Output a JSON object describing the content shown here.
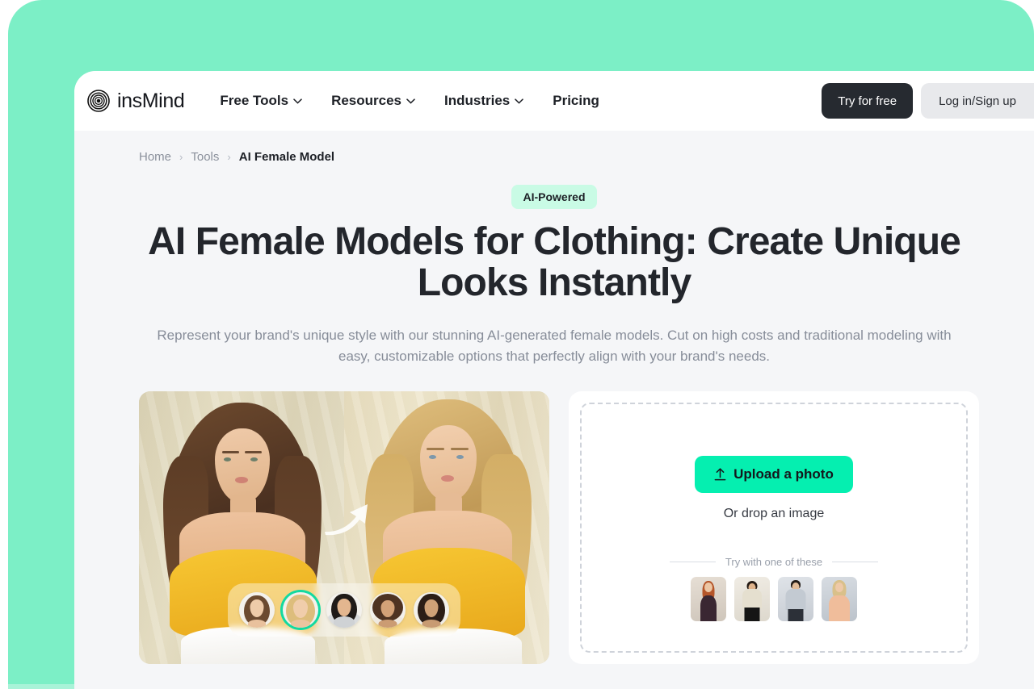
{
  "theme": {
    "frame_mint": "#7cefc6",
    "page_bg": "#f5f6f8",
    "accent_green": "#05efb0",
    "badge_bg": "#c9fbe5",
    "dark_button": "#262a30",
    "selected_ring": "#13d9a0"
  },
  "header": {
    "logo_text": "insMind",
    "nav": [
      {
        "label": "Free Tools",
        "has_chevron": true
      },
      {
        "label": "Resources",
        "has_chevron": true
      },
      {
        "label": "Industries",
        "has_chevron": true
      },
      {
        "label": "Pricing",
        "has_chevron": false
      }
    ],
    "try_free_label": "Try for free",
    "login_label": "Log in/Sign up"
  },
  "breadcrumb": {
    "home": "Home",
    "sep1": "›",
    "tools": "Tools",
    "sep2": "›",
    "current": "AI Female Model"
  },
  "hero": {
    "badge": "AI-Powered",
    "title": "AI Female Models for Clothing: Create Unique Looks Instantly",
    "subtitle": "Represent your brand's unique style with our stunning AI-generated female models. Cut on high costs and traditional modeling with easy, customizable options that perfectly align with your brand's needs."
  },
  "showcase": {
    "before_label": "brunette model in yellow off-shoulder top",
    "after_label": "blonde model in yellow off-shoulder top",
    "arrow_icon": "curved-arrow-icon",
    "avatars": [
      {
        "name": "avatar-brunette-long",
        "selected": false
      },
      {
        "name": "avatar-blonde",
        "selected": true
      },
      {
        "name": "avatar-black-hair-turtleneck",
        "selected": false
      },
      {
        "name": "avatar-curly-brown",
        "selected": false
      },
      {
        "name": "avatar-dark-straight",
        "selected": false
      }
    ]
  },
  "upload": {
    "button_label": "Upload a photo",
    "button_icon": "upload-arrow-icon",
    "drop_hint": "Or drop an image",
    "try_label": "Try with one of these",
    "samples": [
      {
        "name": "sample-redhead-dark-dress"
      },
      {
        "name": "sample-cream-top-black-pants"
      },
      {
        "name": "sample-gray-sweater"
      },
      {
        "name": "sample-blonde-peach-dress"
      }
    ]
  }
}
